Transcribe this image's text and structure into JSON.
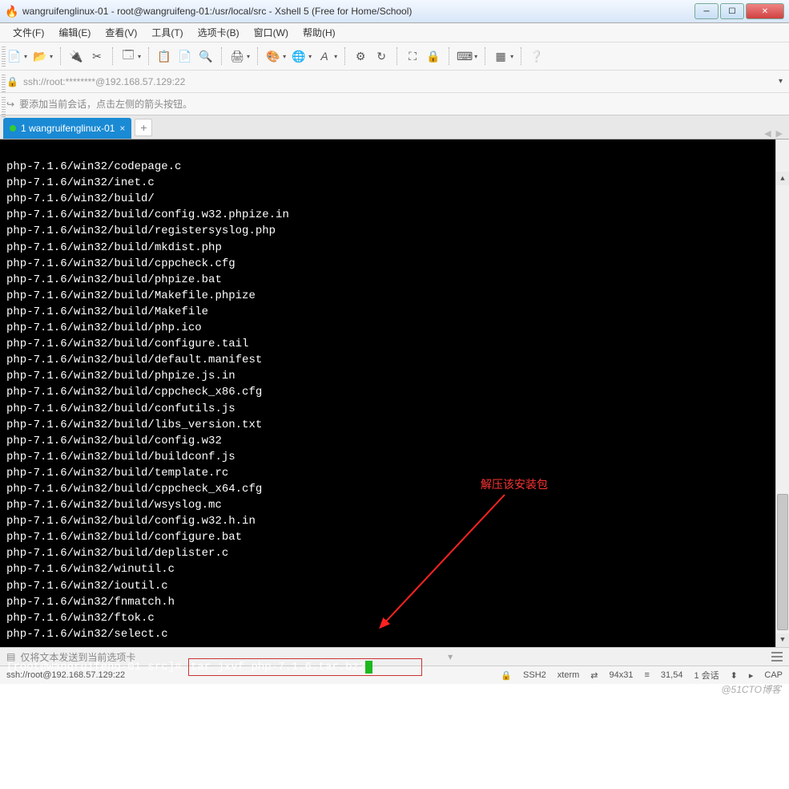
{
  "window": {
    "title": "wangruifenglinux-01 - root@wangruifeng-01:/usr/local/src - Xshell 5 (Free for Home/School)"
  },
  "menu": {
    "items": [
      "文件(F)",
      "编辑(E)",
      "查看(V)",
      "工具(T)",
      "选项卡(B)",
      "窗口(W)",
      "帮助(H)"
    ]
  },
  "address": {
    "lock_icon": "🔒",
    "url": "ssh://root:********@192.168.57.129:22"
  },
  "hint": {
    "text": "要添加当前会话，点击左侧的箭头按钮。"
  },
  "tabs": {
    "items": [
      {
        "label": "1 wangruifenglinux-01"
      }
    ],
    "add": "+"
  },
  "terminal": {
    "lines": [
      "php-7.1.6/win32/codepage.c",
      "php-7.1.6/win32/inet.c",
      "php-7.1.6/win32/build/",
      "php-7.1.6/win32/build/config.w32.phpize.in",
      "php-7.1.6/win32/build/registersyslog.php",
      "php-7.1.6/win32/build/mkdist.php",
      "php-7.1.6/win32/build/cppcheck.cfg",
      "php-7.1.6/win32/build/phpize.bat",
      "php-7.1.6/win32/build/Makefile.phpize",
      "php-7.1.6/win32/build/Makefile",
      "php-7.1.6/win32/build/php.ico",
      "php-7.1.6/win32/build/configure.tail",
      "php-7.1.6/win32/build/default.manifest",
      "php-7.1.6/win32/build/phpize.js.in",
      "php-7.1.6/win32/build/cppcheck_x86.cfg",
      "php-7.1.6/win32/build/confutils.js",
      "php-7.1.6/win32/build/libs_version.txt",
      "php-7.1.6/win32/build/config.w32",
      "php-7.1.6/win32/build/buildconf.js",
      "php-7.1.6/win32/build/template.rc",
      "php-7.1.6/win32/build/cppcheck_x64.cfg",
      "php-7.1.6/win32/build/wsyslog.mc",
      "php-7.1.6/win32/build/config.w32.h.in",
      "php-7.1.6/win32/build/configure.bat",
      "php-7.1.6/win32/build/deplister.c",
      "php-7.1.6/win32/winutil.c",
      "php-7.1.6/win32/ioutil.c",
      "php-7.1.6/win32/fnmatch.h",
      "php-7.1.6/win32/ftok.c",
      "php-7.1.6/win32/select.c"
    ],
    "prompt": "[root@wangruifeng-01 src]# ",
    "command": "tar jxvf php-7.1.6.tar.bz2"
  },
  "annotation": {
    "text": "解压该安装包"
  },
  "sendbar": {
    "text": "仅将文本发送到当前选项卡"
  },
  "status": {
    "conn": "ssh://root@192.168.57.129:22",
    "ssh": "SSH2",
    "term": "xterm",
    "size": "94x31",
    "pos": "31,54",
    "sess": "1 会话",
    "cap": "CAP"
  },
  "watermark": "@51CTO博客"
}
